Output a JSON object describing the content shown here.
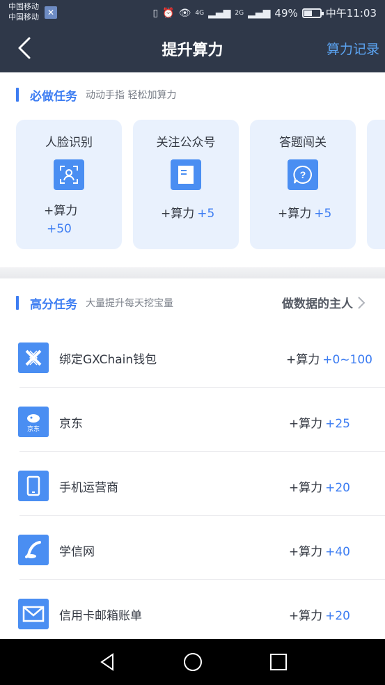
{
  "status_bar": {
    "carrier_1": "中国移动",
    "carrier_2": "中国移动",
    "carrier_badge": "🅧",
    "signal_1": "4G",
    "signal_2": "2G",
    "battery": "49%",
    "time": "中午11:03"
  },
  "header": {
    "title": "提升算力",
    "right_link": "算力记录"
  },
  "must_do": {
    "title": "必做任务",
    "subtitle": "动动手指 轻松加算力",
    "cards": [
      {
        "title": "人脸识别",
        "reward_label": "+算力",
        "reward_value": "+50",
        "icon": "face-scan-icon"
      },
      {
        "title": "关注公众号",
        "reward_label": "+算力",
        "reward_value": "+5",
        "icon": "document-icon"
      },
      {
        "title": "答题闯关",
        "reward_label": "+算力",
        "reward_value": "+5",
        "icon": "question-icon"
      }
    ]
  },
  "high_score": {
    "title": "高分任务",
    "subtitle": "大量提升每天挖宝量",
    "right_link": "做数据的主人",
    "items": [
      {
        "label": "绑定GXChain钱包",
        "reward_label": "+算力",
        "reward_value": "+0~100",
        "icon": "gxchain-icon"
      },
      {
        "label": "京东",
        "reward_label": "+算力",
        "reward_value": "+25",
        "icon": "jd-icon"
      },
      {
        "label": "手机运营商",
        "reward_label": "+算力",
        "reward_value": "+20",
        "icon": "phone-icon"
      },
      {
        "label": "学信网",
        "reward_label": "+算力",
        "reward_value": "+40",
        "icon": "education-icon"
      },
      {
        "label": "信用卡邮箱账单",
        "reward_label": "+算力",
        "reward_value": "+20",
        "icon": "mail-icon"
      }
    ]
  },
  "colors": {
    "header_bg": "#2f3849",
    "accent": "#3d7df2",
    "link": "#5ba3f1",
    "card_bg": "#e9f1fd",
    "icon_bg": "#4a8ef2"
  }
}
